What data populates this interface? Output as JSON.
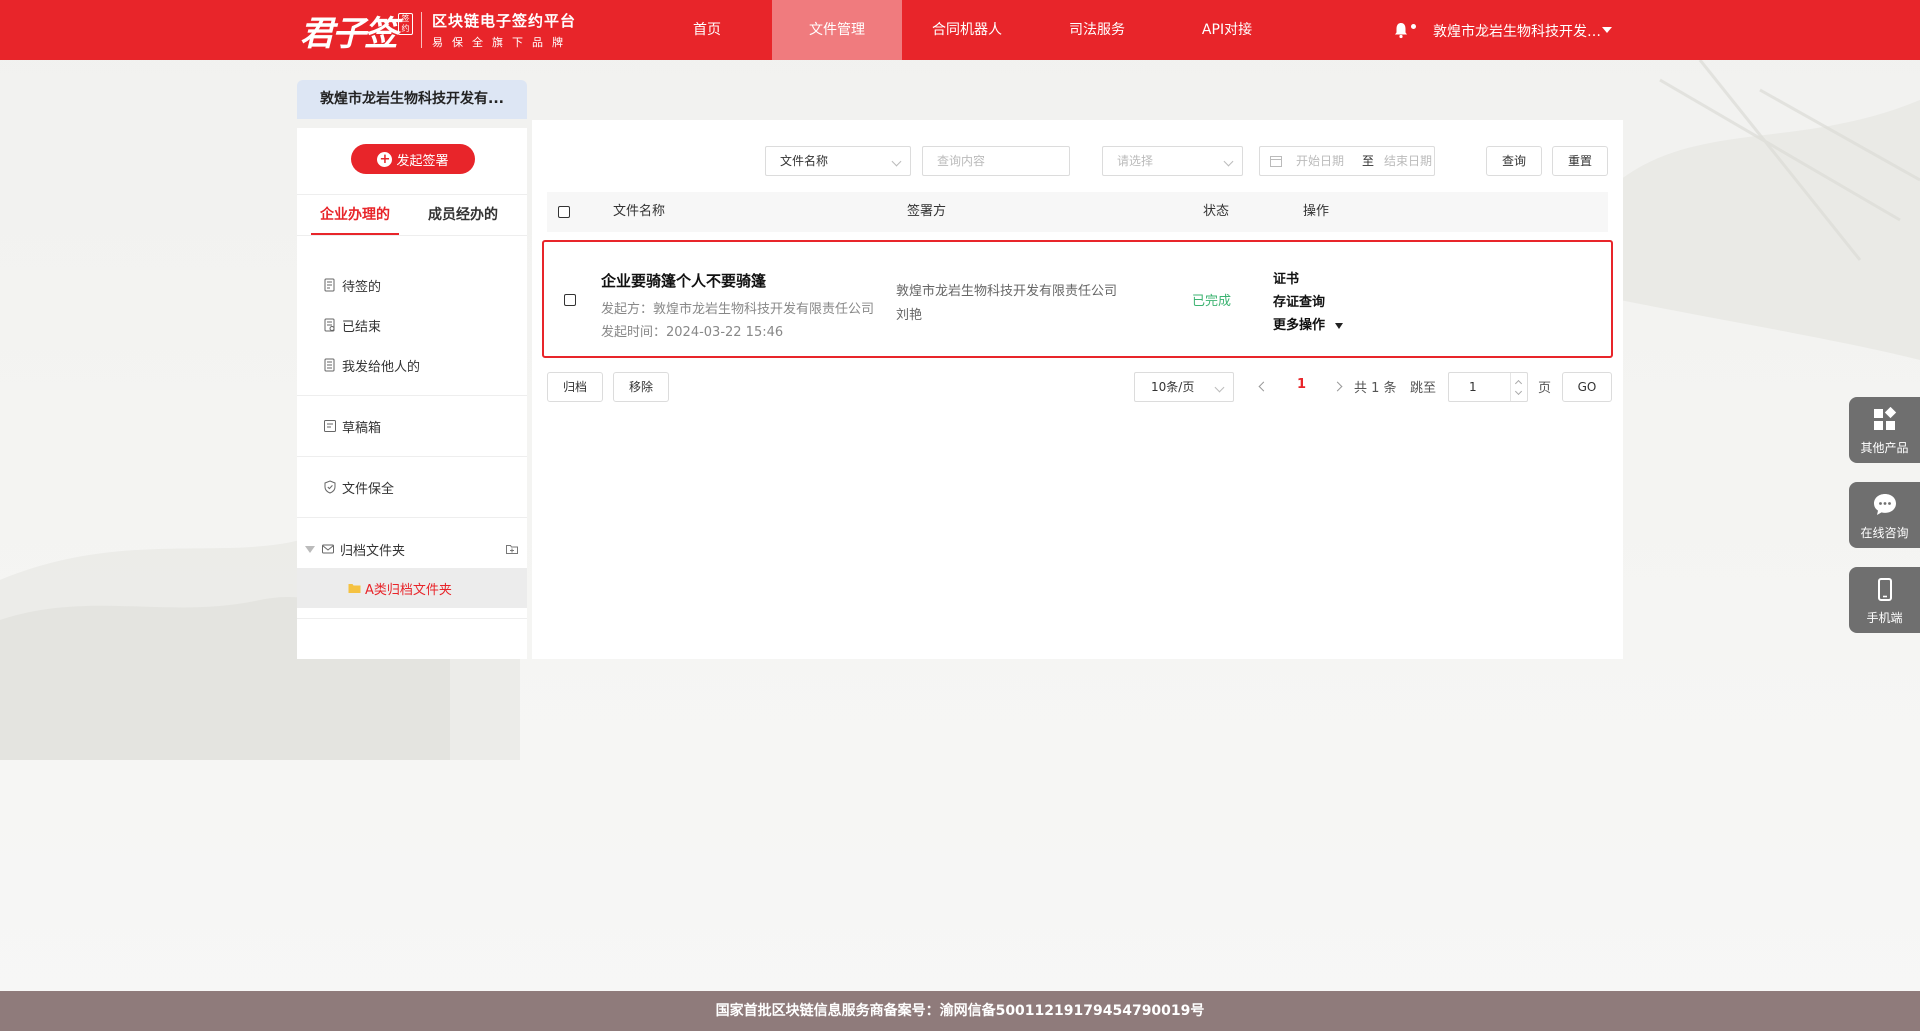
{
  "header": {
    "logo_main": "君子签",
    "logo_seal": "签约",
    "logo_title": "区块链电子签约平台",
    "logo_slogan": "易保全旗下品牌",
    "nav": [
      "首页",
      "文件管理",
      "合同机器人",
      "司法服务",
      "API对接"
    ],
    "active_nav": "文件管理",
    "user_name": "敦煌市龙岩生物科技开发有限责任公司"
  },
  "company_tab": "敦煌市龙岩生物科技开发有...",
  "sidebar": {
    "start_button": "发起签署",
    "tabs": [
      "企业办理的",
      "成员经办的"
    ],
    "menu": {
      "pending": "待签的",
      "finished": "已结束",
      "sent_to_others": "我发给他人的",
      "drafts": "草稿箱",
      "preservation": "文件保全",
      "archive_folder": "归档文件夹",
      "sub_folder": "A类归档文件夹"
    }
  },
  "filters": {
    "field_select": "文件名称",
    "query_placeholder": "查询内容",
    "status_placeholder": "请选择",
    "start_date": "开始日期",
    "to": "至",
    "end_date": "结束日期",
    "search": "查询",
    "reset": "重置"
  },
  "table": {
    "headers": [
      "文件名称",
      "签署方",
      "状态",
      "操作"
    ],
    "rows": [
      {
        "title": "企业要骑篷个人不要骑篷",
        "initiator": "发起方：敦煌市龙岩生物科技开发有限责任公司",
        "time": "发起时间：2024-03-22 15:46",
        "signers": [
          "敦煌市龙岩生物科技开发有限责任公司",
          "刘艳"
        ],
        "status": "已完成",
        "ops": [
          "证书",
          "存证查询",
          "更多操作"
        ]
      }
    ]
  },
  "actions": {
    "archive": "归档",
    "remove": "移除"
  },
  "pagination": {
    "page_size": "10条/页",
    "current_page": "1",
    "total": "共 1 条",
    "jump_to": "跳至",
    "jump_value": "1",
    "page_unit": "页",
    "go": "GO"
  },
  "floating": {
    "other_products": "其他产品",
    "online_consult": "在线咨询",
    "mobile": "手机端"
  },
  "footer": "国家首批区块链信息服务商备案号：渝网信备50011219179454790019号",
  "colors": {
    "brand": "#e8252a",
    "success": "#3cb371",
    "footer": "#8f7b7b"
  }
}
